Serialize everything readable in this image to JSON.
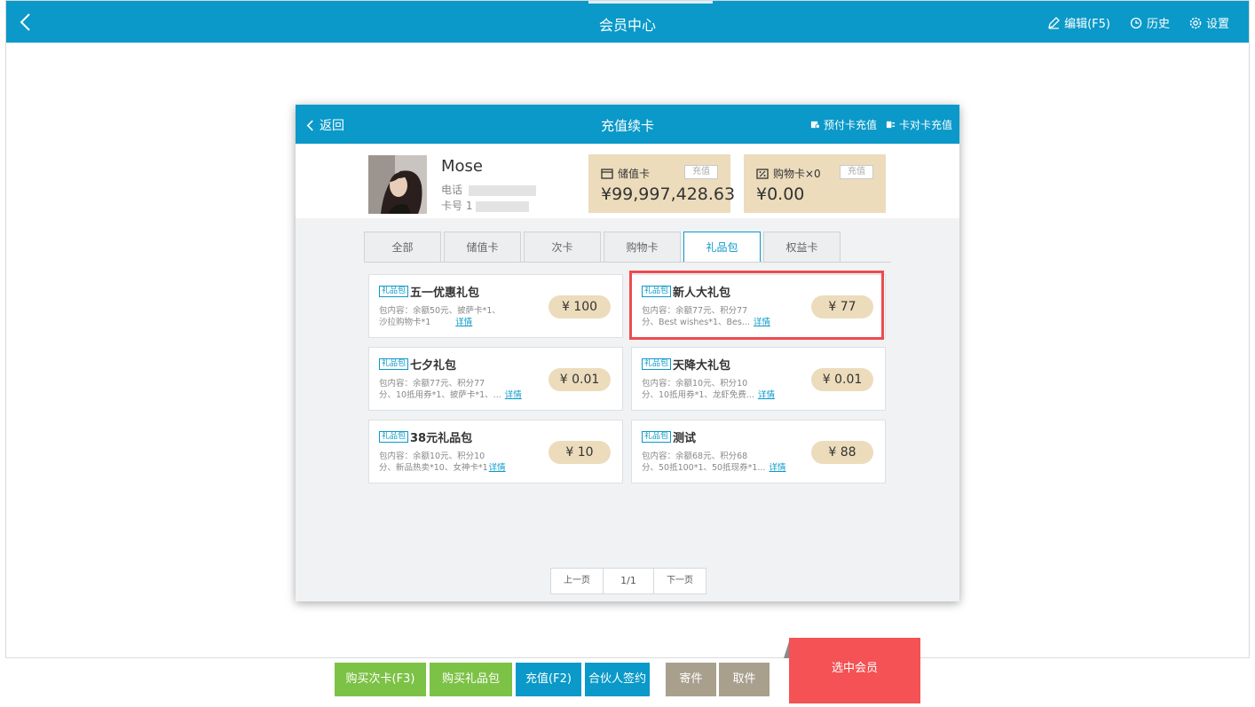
{
  "app": {
    "title": "会员中心"
  },
  "topbar": {
    "actions": [
      {
        "label": "编辑(F5)",
        "icon": "pencil-icon"
      },
      {
        "label": "历史",
        "icon": "clock-icon"
      },
      {
        "label": "设置",
        "icon": "gear-icon"
      }
    ]
  },
  "modal": {
    "back_label": "返回",
    "title": "充值续卡",
    "actions": [
      {
        "label": "预付卡充值",
        "icon": "prepaid-card-icon"
      },
      {
        "label": "卡对卡充值",
        "icon": "card-transfer-icon"
      }
    ]
  },
  "member": {
    "name": "Mose",
    "phone_label": "电话",
    "card_label": "卡号",
    "card_prefix": "1"
  },
  "cards": [
    {
      "title": "储值卡",
      "button": "充值",
      "value": "¥99,997,428.63",
      "icon": "card-icon"
    },
    {
      "title": "购物卡×0",
      "button": "充值",
      "value": "¥0.00",
      "icon": "percent-icon"
    }
  ],
  "tabs": [
    {
      "label": "全部",
      "active": false
    },
    {
      "label": "储值卡",
      "active": false
    },
    {
      "label": "次卡",
      "active": false
    },
    {
      "label": "购物卡",
      "active": false
    },
    {
      "label": "礼品包",
      "active": true
    },
    {
      "label": "权益卡",
      "active": false
    }
  ],
  "gifts": [
    {
      "tag": "礼品包",
      "name": "五一优惠礼包",
      "desc_line1": "包内容：余额50元、披萨卡*1、",
      "desc_line2": "沙拉购物卡*1",
      "detail": "详情",
      "price": "¥ 100"
    },
    {
      "tag": "礼品包",
      "name": "新人大礼包",
      "desc_line1": "包内容：余额77元、积分77",
      "desc_line2": "分、Best wishes*1、Bes...",
      "detail": "详情",
      "price": "¥ 77"
    },
    {
      "tag": "礼品包",
      "name": "七夕礼包",
      "desc_line1": "包内容：余额77元、积分77",
      "desc_line2": "分、10抵用券*1、披萨卡*1、...",
      "detail": "详情",
      "price": "¥ 0.01"
    },
    {
      "tag": "礼品包",
      "name": "天降大礼包",
      "desc_line1": "包内容：余额10元、积分10",
      "desc_line2": "分、10抵用券*1、龙虾免费...",
      "detail": "详情",
      "price": "¥ 0.01"
    },
    {
      "tag": "礼品包",
      "name": "38元礼品包",
      "desc_line1": "包内容：余额10元、积分10",
      "desc_line2": "分、新品热卖*10、女神卡*1",
      "detail": "详情",
      "price": "¥ 10"
    },
    {
      "tag": "礼品包",
      "name": "测试",
      "desc_line1": "包内容：余额68元、积分68",
      "desc_line2": "分、50抵100*1、50抵现券*1...",
      "detail": "详情",
      "price": "¥ 88"
    }
  ],
  "pager": {
    "prev": "上一页",
    "page": "1/1",
    "next": "下一页"
  },
  "bottom": {
    "buttons": [
      {
        "label": "购买次卡(F3)",
        "color": "#7cc246"
      },
      {
        "label": "购买礼品包",
        "color": "#7cc246"
      },
      {
        "label": "充值(F2)",
        "color": "#0a99c9"
      },
      {
        "label": "合伙人签约",
        "color": "#0a99c9"
      },
      {
        "label": "寄件",
        "color": "#a89f8d"
      },
      {
        "label": "取件",
        "color": "#a89f8d"
      }
    ],
    "select_member": "选中会员",
    "select_color": "#f45254"
  },
  "colors": {
    "primary": "#0a99c9",
    "card_bg": "#ecdcbc",
    "highlight": "#ee4b4e"
  }
}
